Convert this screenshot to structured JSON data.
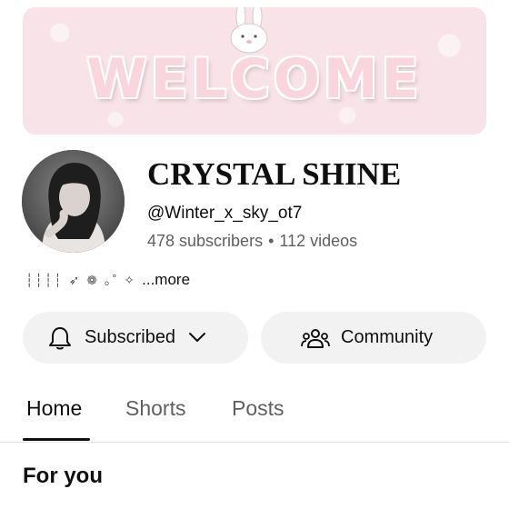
{
  "banner": {
    "text": "WELCOME",
    "background_color": "#f7e3e8"
  },
  "channel": {
    "name": "CRYSTAL SHINE",
    "handle": "@Winter_x_sky_ot7",
    "subscribers": "478 subscribers",
    "separator": "•",
    "videos": "112 videos",
    "bio_decor": "┆┆┆┆ ➶ ❁ ｡˚ ✧",
    "bio_more": "...more"
  },
  "actions": {
    "subscribed_label": "Subscribed",
    "community_label": "Community",
    "button_color": "#f2f2f2"
  },
  "tabs": [
    {
      "label": "Home",
      "active": true
    },
    {
      "label": "Shorts",
      "active": false
    },
    {
      "label": "Posts",
      "active": false
    }
  ],
  "section": {
    "title": "For you"
  },
  "icons": {
    "bell": "bell-icon",
    "chevron": "chevron-down-icon",
    "community": "community-icon"
  }
}
